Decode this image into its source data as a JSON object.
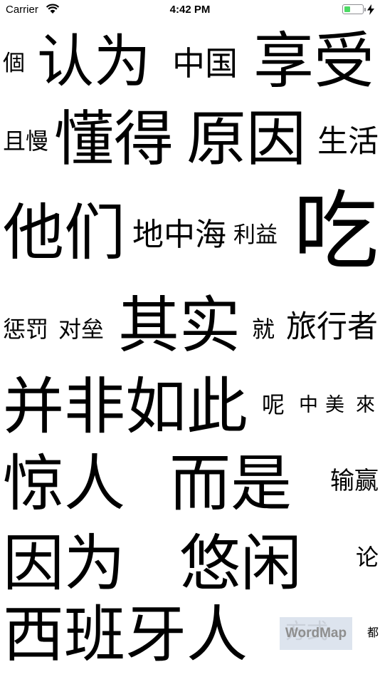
{
  "status_bar": {
    "carrier": "Carrier",
    "time": "4:42 PM",
    "wifi_icon": "wifi-icon",
    "battery_icon": "battery-icon",
    "charging_icon": "charging-bolt-icon",
    "battery_level": 0.35,
    "battery_color": "#4cd964"
  },
  "words": [
    "個",
    "认为",
    "中国",
    "享受",
    "且慢",
    "懂得",
    "原因",
    "生活",
    "他们",
    "地中海",
    "利益",
    "吃",
    "惩罚",
    "对垒",
    "其实",
    "就",
    "旅行者",
    "并非如此",
    "呢",
    "中美",
    "來",
    "惊人",
    "而是",
    "输赢",
    "因为",
    "悠闲",
    "论",
    "西班牙人",
    "都"
  ],
  "watermark": {
    "text": "WordMap",
    "ghost_text": "方式",
    "background": "#dde4ee"
  }
}
